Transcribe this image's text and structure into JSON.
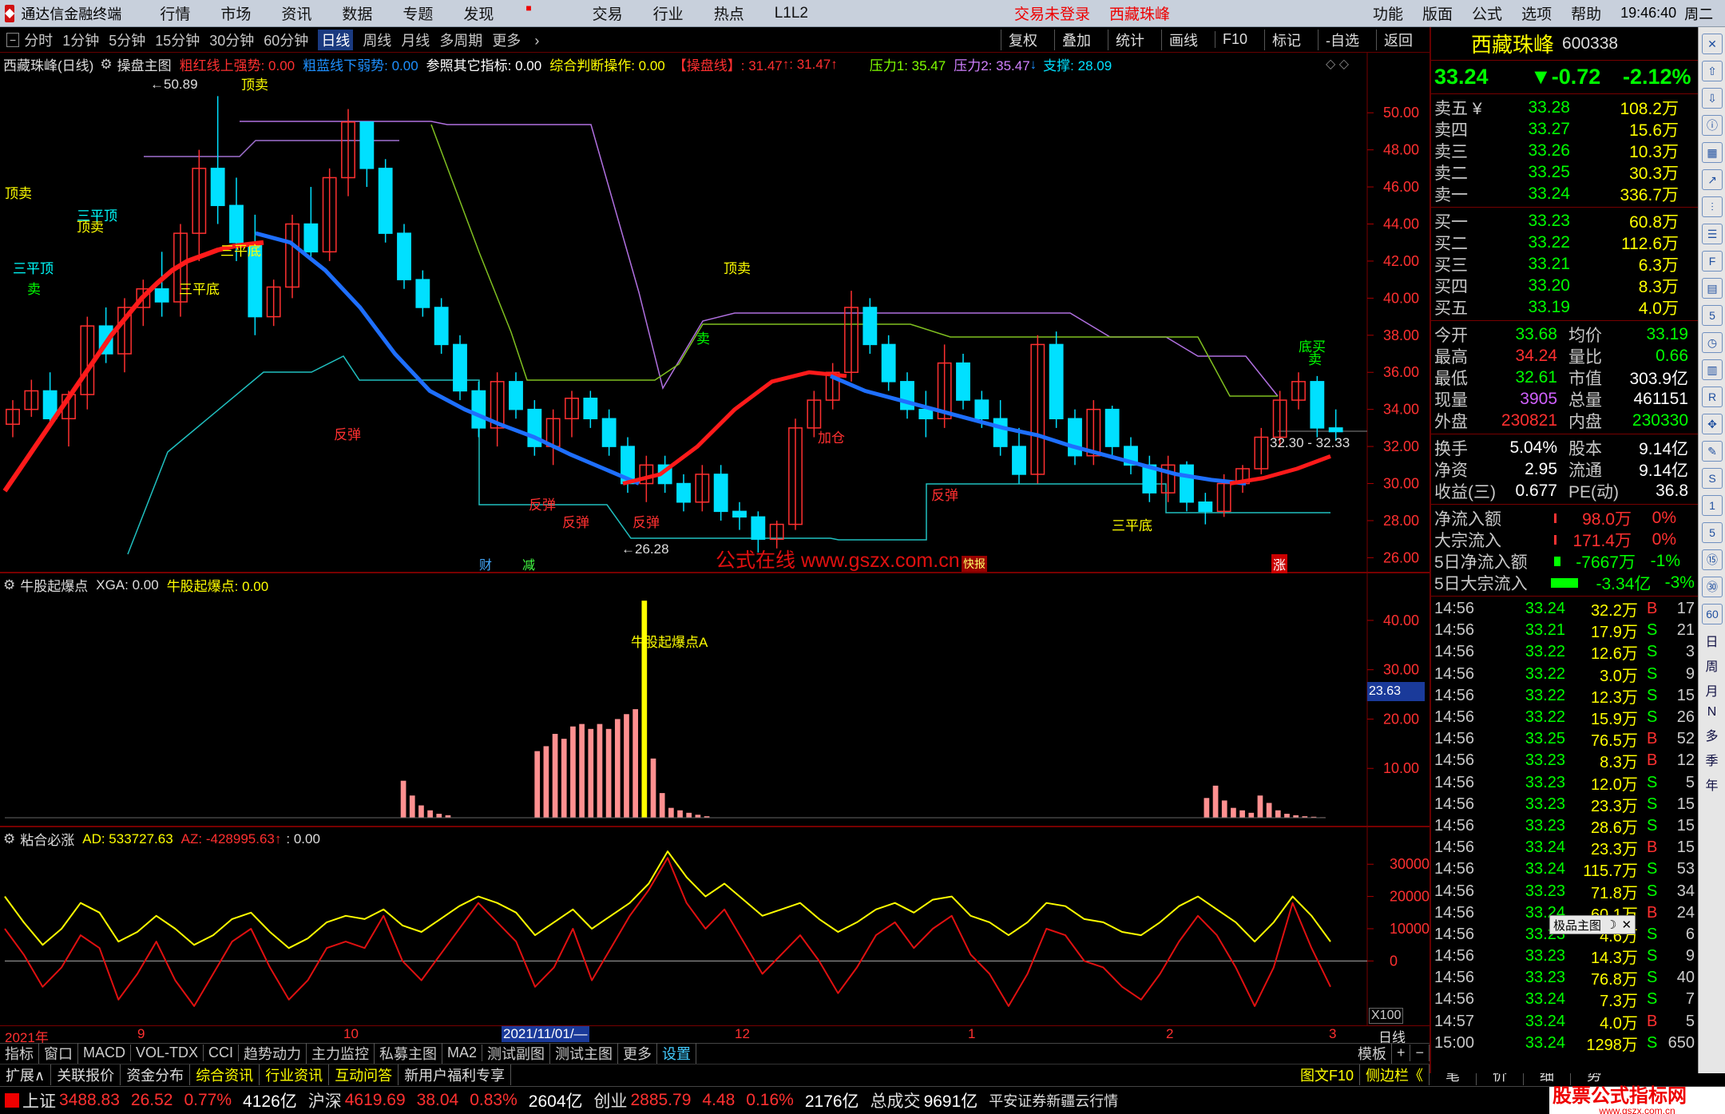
{
  "app": {
    "title": "通达信金融终端",
    "menus": [
      "行情",
      "市场",
      "资讯",
      "数据",
      "专题",
      "发现",
      "交易",
      "行业",
      "热点",
      "L1L2"
    ],
    "status": "交易未登录",
    "stock_name_top": "西藏珠峰",
    "right_menus": [
      "功能",
      "版面",
      "公式",
      "选项",
      "帮助"
    ],
    "clock": "19:46:40",
    "weekday": "周二"
  },
  "periods": [
    "分时",
    "1分钟",
    "5分钟",
    "15分钟",
    "30分钟",
    "60分钟",
    "日线",
    "周线",
    "月线",
    "多周期",
    "更多"
  ],
  "selected_period": "日线",
  "more_arrow": "›",
  "tools": [
    "复权",
    "叠加",
    "统计",
    "画线",
    "F10",
    "标记",
    "-自选",
    "返回"
  ],
  "main_chart": {
    "header": "西藏珠峰(日线)",
    "template": "操盘主图",
    "ind1": "粗红线上强势: 0.00",
    "ind2": "粗蓝线下弱势: 0.00",
    "ind3": "参照其它指标: 0.00",
    "ind4": "综合判断操作: 0.00",
    "ind5": "【操盘线】: 31.47",
    "ind5b": ": 31.47",
    "ind6": "压力1: 35.47",
    "ind7": "压力2: 35.47",
    "ind8": "支撑: 28.09",
    "up": "↑",
    "down": "↓",
    "y_ticks": [
      "50.00",
      "48.00",
      "46.00",
      "44.00",
      "42.00",
      "40.00",
      "38.00",
      "36.00",
      "34.00",
      "32.00",
      "30.00",
      "28.00",
      "26.00"
    ],
    "high_label": "50.89",
    "low_label": "26.28",
    "range_label": "32.30 - 32.33",
    "watermark": "公式在线  www.gszx.com.cn",
    "signals": {
      "ding_mai": "顶卖",
      "san_ping_ding": "三平顶",
      "san_ping_di": "三平底",
      "sell": "卖",
      "fan_tan": "反弹",
      "jia_cang": "加仓",
      "di_mai": "底买",
      "cai": "财",
      "jian": "减",
      "zhang": "涨",
      "kuai_bao": "快报",
      "tiao": "买"
    }
  },
  "sub1": {
    "name": "牛股起爆点",
    "xga": "XGA: 0.00",
    "val": "牛股起爆点: 0.00",
    "annotation": "牛股起爆点A",
    "y_ticks": [
      "40.00",
      "30.00",
      "20.00",
      "10.00"
    ],
    "current": "23.63"
  },
  "sub2": {
    "name": "粘合必涨",
    "ad": "AD: 533727.63",
    "az": "AZ: -428995.63",
    "arrow": "↑",
    "extra": ": 0.00",
    "y_ticks": [
      "30000",
      "20000",
      "10000",
      "0"
    ],
    "scale": "X100"
  },
  "x_axis": {
    "labels": [
      "2021年",
      "9",
      "10",
      "2021/11/01/—",
      "12",
      "1",
      "2",
      "3"
    ],
    "right": "日线"
  },
  "chart_data": [
    {
      "type": "candlestick",
      "title": "西藏珠峰(日线)",
      "ylim": [
        25.5,
        51
      ],
      "series": [
        {
          "name": "粗红线上强势",
          "values": [
            29.6,
            30.8,
            32.0,
            33.2,
            34.4,
            35.6,
            36.8,
            38.0,
            39.0,
            40.0,
            40.8,
            41.5,
            42.0,
            42.3,
            42.6,
            42.8,
            42.9,
            43.0
          ]
        },
        {
          "name": "操盘线",
          "values": [
            43.5,
            43.0,
            41.5,
            39.5,
            37.0,
            35.0,
            34.0,
            33.2,
            32.5,
            31.6,
            30.8,
            30.0,
            30.5,
            32.0,
            34.0,
            35.5,
            36.0,
            35.8,
            35.0,
            34.5,
            34.0,
            33.5,
            33.0,
            32.6,
            32.0,
            31.5,
            31.0,
            30.5,
            30.2,
            30.0,
            30.3,
            30.8,
            31.47
          ]
        }
      ],
      "candles": [
        [
          33.2,
          34.5,
          32.5,
          34.0
        ],
        [
          34.0,
          35.6,
          33.6,
          35.0
        ],
        [
          35.0,
          36.0,
          33.0,
          33.5
        ],
        [
          33.5,
          35.0,
          32.0,
          34.8
        ],
        [
          34.8,
          39.0,
          34.0,
          38.5
        ],
        [
          38.5,
          39.5,
          36.5,
          37.0
        ],
        [
          37.0,
          40.0,
          36.0,
          39.5
        ],
        [
          39.5,
          41.0,
          38.5,
          40.5
        ],
        [
          40.5,
          42.5,
          39.0,
          39.8
        ],
        [
          39.8,
          44.0,
          39.0,
          43.5
        ],
        [
          43.5,
          48.0,
          42.0,
          47.0
        ],
        [
          47.0,
          50.9,
          44.0,
          45.0
        ],
        [
          45.0,
          46.5,
          42.0,
          43.0
        ],
        [
          43.0,
          44.5,
          38.0,
          39.0
        ],
        [
          39.0,
          41.0,
          38.5,
          40.6
        ],
        [
          40.6,
          44.5,
          40.0,
          44.0
        ],
        [
          44.0,
          46.0,
          42.0,
          42.5
        ],
        [
          42.5,
          47.0,
          42.0,
          46.5
        ],
        [
          46.5,
          50.2,
          45.5,
          49.5
        ],
        [
          49.5,
          48.5,
          46.0,
          47.0
        ],
        [
          47.0,
          47.5,
          43.0,
          43.5
        ],
        [
          43.5,
          44.0,
          40.5,
          41.0
        ],
        [
          41.0,
          41.5,
          39.0,
          39.5
        ],
        [
          39.5,
          40.0,
          37.0,
          37.5
        ],
        [
          37.5,
          38.0,
          34.5,
          35.0
        ],
        [
          35.0,
          35.5,
          32.5,
          33.0
        ],
        [
          33.0,
          36.0,
          32.0,
          35.5
        ],
        [
          35.5,
          36.0,
          33.5,
          34.0
        ],
        [
          34.0,
          34.5,
          31.5,
          32.0
        ],
        [
          32.0,
          34.0,
          31.0,
          33.5
        ],
        [
          33.5,
          35.0,
          32.5,
          34.6
        ],
        [
          34.6,
          35.0,
          33.0,
          33.5
        ],
        [
          33.5,
          34.0,
          31.5,
          32.0
        ],
        [
          32.0,
          32.5,
          29.5,
          30.0
        ],
        [
          30.0,
          31.5,
          29.0,
          31.0
        ],
        [
          31.0,
          31.5,
          29.5,
          30.0
        ],
        [
          30.0,
          30.5,
          28.5,
          29.0
        ],
        [
          29.0,
          31.0,
          28.5,
          30.5
        ],
        [
          30.5,
          31.0,
          28.0,
          28.5
        ],
        [
          28.5,
          29.0,
          27.5,
          28.2
        ],
        [
          28.2,
          28.5,
          26.28,
          27.0
        ],
        [
          27.0,
          28.0,
          26.5,
          27.8
        ],
        [
          27.8,
          33.5,
          27.5,
          33.0
        ],
        [
          33.0,
          35.0,
          32.5,
          34.5
        ],
        [
          34.5,
          36.5,
          34.0,
          36.0
        ],
        [
          36.0,
          40.4,
          35.5,
          39.5
        ],
        [
          39.5,
          40.0,
          37.0,
          37.5
        ],
        [
          37.5,
          38.0,
          35.0,
          35.5
        ],
        [
          35.5,
          36.0,
          33.5,
          34.0
        ],
        [
          34.0,
          35.0,
          32.5,
          33.5
        ],
        [
          33.5,
          37.5,
          33.0,
          36.5
        ],
        [
          36.5,
          37.0,
          34.0,
          34.5
        ],
        [
          34.5,
          35.0,
          33.0,
          33.5
        ],
        [
          33.5,
          34.5,
          31.5,
          32.0
        ],
        [
          32.0,
          33.0,
          30.0,
          30.5
        ],
        [
          30.5,
          38.0,
          30.0,
          37.5
        ],
        [
          37.5,
          38.2,
          33.0,
          33.5
        ],
        [
          33.5,
          34.0,
          31.0,
          31.5
        ],
        [
          31.5,
          34.5,
          31.0,
          34.0
        ],
        [
          34.0,
          34.2,
          31.5,
          32.0
        ],
        [
          32.0,
          32.5,
          30.5,
          31.0
        ],
        [
          31.0,
          31.5,
          29.0,
          29.5
        ],
        [
          29.5,
          31.5,
          29.0,
          31.0
        ],
        [
          31.0,
          31.2,
          28.5,
          29.0
        ],
        [
          29.0,
          29.5,
          27.8,
          28.5
        ],
        [
          28.5,
          30.5,
          28.2,
          30.0
        ],
        [
          30.0,
          31.0,
          29.5,
          30.8
        ],
        [
          30.8,
          33.0,
          30.5,
          32.5
        ],
        [
          32.5,
          35.0,
          32.0,
          34.5
        ],
        [
          34.5,
          36.0,
          34.0,
          35.5
        ],
        [
          35.5,
          35.8,
          32.5,
          33.0
        ],
        [
          33.0,
          34.0,
          32.3,
          32.8
        ]
      ]
    },
    {
      "type": "bar",
      "title": "牛股起爆点",
      "ylim": [
        0,
        45
      ],
      "values": [
        0,
        0,
        0,
        0,
        0,
        0,
        0,
        0,
        0,
        0,
        0,
        0,
        0,
        0,
        0,
        0,
        0,
        0,
        0,
        0,
        0,
        0,
        0,
        0,
        0,
        0,
        0,
        0,
        0,
        0,
        0,
        0,
        0,
        0,
        0,
        0,
        0,
        0,
        0,
        0,
        0,
        0,
        0,
        0,
        7.5,
        4.5,
        2.5,
        1.5,
        0.8,
        0.5,
        0,
        0,
        0,
        0,
        0,
        0,
        0,
        0,
        0,
        13.5,
        14.5,
        17,
        16,
        18.5,
        19,
        18,
        19,
        18,
        20,
        21,
        22,
        44,
        12,
        5,
        2,
        1.5,
        1,
        0.6,
        0.3,
        0,
        0,
        0,
        0,
        0,
        0,
        0,
        0,
        0,
        0,
        0,
        0,
        0,
        0,
        0,
        0,
        0,
        0,
        0,
        0,
        0,
        0,
        0,
        0,
        0,
        0,
        0,
        0,
        0,
        0,
        0,
        0,
        0,
        0,
        0,
        0,
        0,
        0,
        0,
        0,
        0,
        0,
        0,
        0,
        0,
        0,
        0,
        0,
        0,
        0,
        0,
        0,
        0,
        0,
        0,
        4,
        6.5,
        3.5,
        2,
        1.5,
        1,
        4.5,
        3,
        1.5,
        0.8,
        0.5,
        0.3,
        0.2,
        0.1
      ]
    },
    {
      "type": "line",
      "title": "粘合必涨",
      "ylim": [
        -17000,
        36000
      ],
      "series": [
        {
          "name": "AD",
          "values": [
            20000,
            12000,
            5000,
            10000,
            18000,
            15000,
            6000,
            9000,
            14000,
            10000,
            5000,
            8000,
            13000,
            15000,
            9000,
            4000,
            7000,
            12000,
            14000,
            13000,
            16000,
            11000,
            9000,
            13000,
            17000,
            20000,
            18000,
            15000,
            8000,
            12000,
            16000,
            10000,
            14000,
            18000,
            24000,
            34000,
            26000,
            20000,
            24000,
            19000,
            14000,
            16000,
            18000,
            13000,
            9000,
            12000,
            16000,
            18000,
            15000,
            19000,
            20000,
            14000,
            12000,
            8000,
            12000,
            18000,
            17000,
            13000,
            12000,
            9000,
            8000,
            12000,
            17000,
            20000,
            16000,
            12000,
            6000,
            12000,
            20000,
            14000,
            6000
          ]
        },
        {
          "name": "AZ",
          "values": [
            10000,
            2000,
            -8000,
            -2000,
            8000,
            4000,
            -12000,
            -4000,
            6000,
            -6000,
            -14000,
            -4000,
            6000,
            10000,
            -2000,
            -12000,
            -6000,
            4000,
            6000,
            4000,
            14000,
            0,
            -6000,
            2000,
            10000,
            18000,
            12000,
            6000,
            -8000,
            -2000,
            10000,
            -6000,
            4000,
            14000,
            22000,
            32000,
            18000,
            10000,
            16000,
            6000,
            -4000,
            2000,
            8000,
            0,
            -10000,
            -2000,
            8000,
            12000,
            4000,
            10000,
            14000,
            2000,
            -4000,
            -14000,
            -4000,
            10000,
            8000,
            0,
            -2000,
            -8000,
            -12000,
            -4000,
            6000,
            14000,
            8000,
            -2000,
            -14000,
            -2000,
            18000,
            4000,
            -8000
          ]
        }
      ]
    }
  ],
  "quote": {
    "name": "西藏珠峰",
    "code": "600338",
    "price": "33.24",
    "change": "▼-0.72",
    "pct": "-2.12%",
    "asks": [
      {
        "l": "卖五",
        "m": "¥",
        "p": "33.28",
        "v": "108.2万"
      },
      {
        "l": "卖四",
        "m": "",
        "p": "33.27",
        "v": "15.6万"
      },
      {
        "l": "卖三",
        "m": "",
        "p": "33.26",
        "v": "10.3万"
      },
      {
        "l": "卖二",
        "m": "",
        "p": "33.25",
        "v": "30.3万"
      },
      {
        "l": "卖一",
        "m": "",
        "p": "33.24",
        "v": "336.7万"
      }
    ],
    "bids": [
      {
        "l": "买一",
        "p": "33.23",
        "v": "60.8万"
      },
      {
        "l": "买二",
        "p": "33.22",
        "v": "112.6万"
      },
      {
        "l": "买三",
        "p": "33.21",
        "v": "6.3万"
      },
      {
        "l": "买四",
        "p": "33.20",
        "v": "8.3万"
      },
      {
        "l": "买五",
        "p": "33.19",
        "v": "4.0万"
      }
    ],
    "stats": [
      [
        "今开",
        "33.68",
        "均价",
        "33.19"
      ],
      [
        "最高",
        "34.24",
        "量比",
        "0.66"
      ],
      [
        "最低",
        "32.61",
        "市值",
        "303.9亿"
      ],
      [
        "现量",
        "3905",
        "总量",
        "461151"
      ],
      [
        "外盘",
        "230821",
        "内盘",
        "230330"
      ]
    ],
    "stats2": [
      [
        "换手",
        "5.04%",
        "股本",
        "9.14亿"
      ],
      [
        "净资",
        "2.95",
        "流通",
        "9.14亿"
      ],
      [
        "收益(三)",
        "0.677",
        "PE(动)",
        "36.8"
      ]
    ],
    "flows": [
      {
        "l": "净流入额",
        "v": "98.0万",
        "p": "0%"
      },
      {
        "l": "大宗流入",
        "v": "171.4万",
        "p": "0%"
      },
      {
        "l": "5日净流入额",
        "v": "-7667万",
        "p": "-1%"
      },
      {
        "l": "5日大宗流入",
        "v": "-3.34亿",
        "p": "-3%"
      }
    ],
    "ticks": [
      [
        "14:56",
        "33.24",
        "32.2万",
        "B",
        "17"
      ],
      [
        "14:56",
        "33.21",
        "17.9万",
        "S",
        "21"
      ],
      [
        "14:56",
        "33.22",
        "12.6万",
        "S",
        "3"
      ],
      [
        "14:56",
        "33.22",
        "3.0万",
        "S",
        "9"
      ],
      [
        "14:56",
        "33.22",
        "12.3万",
        "S",
        "15"
      ],
      [
        "14:56",
        "33.22",
        "15.9万",
        "S",
        "26"
      ],
      [
        "14:56",
        "33.25",
        "76.5万",
        "B",
        "52"
      ],
      [
        "14:56",
        "33.23",
        "8.3万",
        "B",
        "12"
      ],
      [
        "14:56",
        "33.23",
        "12.0万",
        "S",
        "5"
      ],
      [
        "14:56",
        "33.23",
        "23.3万",
        "S",
        "15"
      ],
      [
        "14:56",
        "33.23",
        "28.6万",
        "S",
        "15"
      ],
      [
        "14:56",
        "33.24",
        "23.3万",
        "B",
        "15"
      ],
      [
        "14:56",
        "33.24",
        "115.7万",
        "S",
        "53"
      ],
      [
        "14:56",
        "33.23",
        "71.8万",
        "S",
        "34"
      ],
      [
        "14:56",
        "33.24",
        "60.1万",
        "B",
        "24"
      ],
      [
        "14:56",
        "33.23",
        "4.6万",
        "S",
        "6"
      ],
      [
        "14:56",
        "33.23",
        "14.3万",
        "S",
        "9"
      ],
      [
        "14:56",
        "33.23",
        "76.8万",
        "S",
        "40"
      ],
      [
        "14:56",
        "33.24",
        "7.3万",
        "S",
        "7"
      ],
      [
        "14:57",
        "33.24",
        "4.0万",
        "B",
        "5"
      ],
      [
        "15:00",
        "33.24",
        "1298万",
        "S",
        "650"
      ]
    ],
    "popup": "极品主图"
  },
  "sidebar": [
    "日",
    "周",
    "月",
    "N",
    "多",
    "季",
    "年"
  ],
  "tabs1": [
    "指标",
    "窗口",
    "MACD",
    "VOL-TDX",
    "CCI",
    "趋势动力",
    "主力监控",
    "私募主图",
    "MA2",
    "测试副图",
    "测试主图",
    "更多",
    "设置"
  ],
  "tabs1_right": [
    "模板",
    "+",
    "−"
  ],
  "tabs2": [
    "扩展∧",
    "关联报价",
    "资金分布",
    "综合资讯",
    "行业资讯",
    "互动问答",
    "新用户福利专享"
  ],
  "tabs2_right": [
    "图文F10",
    "侧边栏《",
    "笔",
    "价",
    "细",
    "势"
  ],
  "footer": {
    "sh_label": "上证",
    "sh": "3488.83",
    "sh_chg": "26.52",
    "sh_pct": "0.77%",
    "sh_amt": "4126亿",
    "sz_label": "沪深",
    "sz": "4619.69",
    "sz_chg": "38.04",
    "sz_pct": "0.83%",
    "sz_amt": "2604亿",
    "cy_label": "创业",
    "cy": "2885.79",
    "cy_chg": "4.48",
    "cy_pct": "0.16%",
    "cy_amt": "2176亿",
    "total_label": "总成交",
    "total": "9691亿",
    "broker": "平安证券新疆云行情",
    "brand": "股票公式指标网",
    "brand_url": "www.gszx.com.cn"
  },
  "colors": {
    "up": "#ff3030",
    "down": "#00e0ff",
    "bull_line": "#ff1a1a",
    "op_line": "#1e6fff",
    "ad": "#ffff00",
    "az": "#e01010",
    "bar": "#ff9090",
    "spike": "#ffff00"
  }
}
